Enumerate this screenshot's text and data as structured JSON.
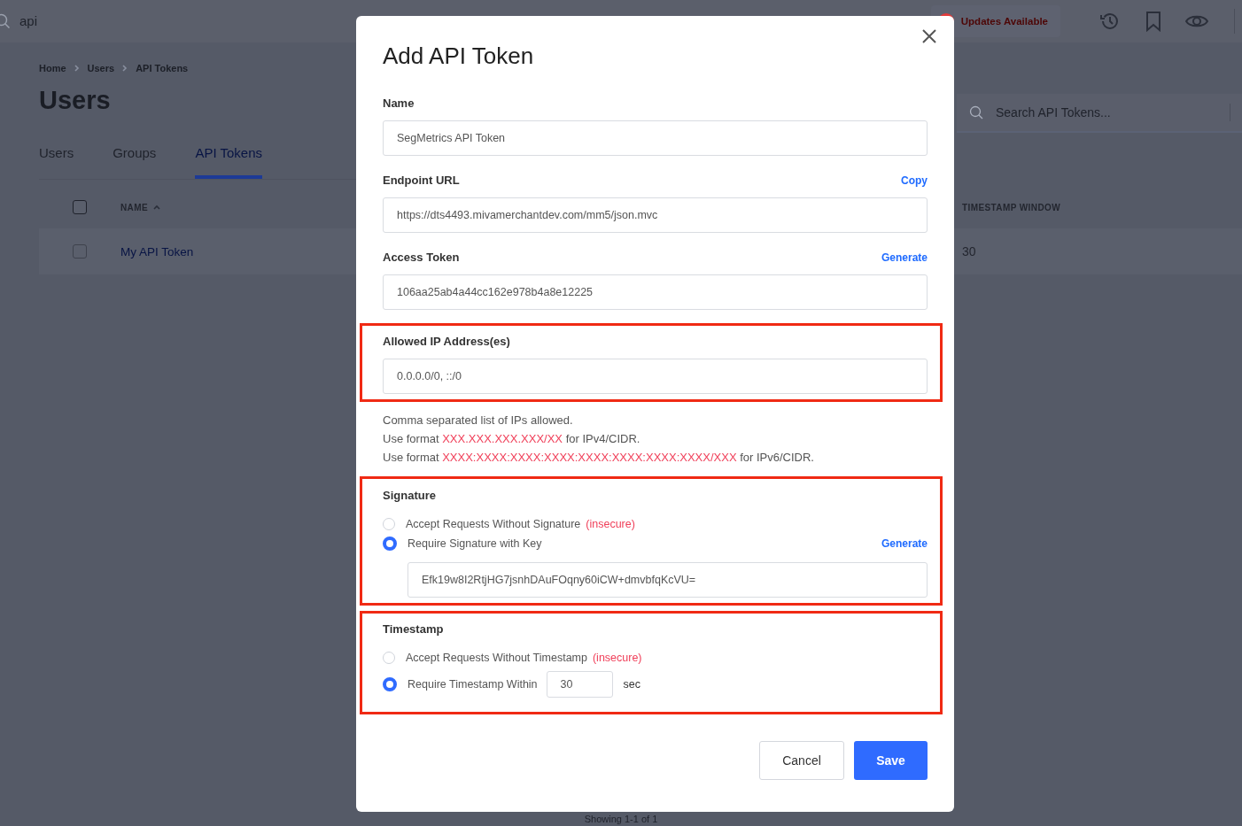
{
  "topbar": {
    "search_value": "api",
    "updates_badge": "Updates Available"
  },
  "breadcrumb": [
    "Home",
    "Users",
    "API Tokens"
  ],
  "page_title": "Users",
  "tabs": [
    {
      "label": "Users",
      "selected": false
    },
    {
      "label": "Groups",
      "selected": false
    },
    {
      "label": "API Tokens",
      "selected": true
    }
  ],
  "table_search": {
    "placeholder": "Search API Tokens..."
  },
  "table": {
    "select_all_checked": false,
    "columns": [
      {
        "label": "NAME",
        "sorted": true
      },
      {
        "label": "TIMESTAMP WINDOW",
        "sorted": false
      }
    ],
    "rows": [
      {
        "checked": false,
        "name": "My API Token",
        "timestamp_window": "30"
      }
    ]
  },
  "footer": "Showing 1-1 of 1",
  "dialog": {
    "title": "Add API Token",
    "fields": [
      {
        "label": "Name",
        "value": "SegMetrics API Token"
      },
      {
        "label": "Endpoint URL",
        "action": "Copy",
        "value": "https://dts4493.mivamerchantdev.com/mm5/json.mvc"
      },
      {
        "label": "Access Token",
        "action": "Generate",
        "value": "106aa25ab4a44cc162e978b4a8e12225"
      }
    ],
    "allowed_ips": {
      "highlighted": true,
      "label": "Allowed IP Address(es)",
      "value": "0.0.0.0/0, ::/0",
      "help": [
        {
          "text": "Comma separated list of IPs allowed."
        },
        {
          "text": "Use format",
          "code": "XXX.XXX.XXX.XXX/XX",
          "suffix": "for IPv4/CIDR."
        },
        {
          "text": "Use format",
          "code": "XXXX:XXXX:XXXX:XXXX:XXXX:XXXX:XXXX:XXXX/XXX",
          "suffix": "for IPv6/CIDR."
        }
      ]
    },
    "signature": {
      "highlighted": true,
      "label": "Signature",
      "options": [
        {
          "label": "Accept Requests Without Signature",
          "tag": "(insecure)",
          "selected": false
        },
        {
          "label": "Require Signature with Key",
          "action": "Generate",
          "selected": true
        }
      ],
      "key_value": "Efk19w8I2RtjHG7jsnhDAuFOqny60iCW+dmvbfqKcVU="
    },
    "timestamp": {
      "highlighted": true,
      "label": "Timestamp",
      "options": [
        {
          "label": "Accept Requests Without Timestamp",
          "tag": "(insecure)",
          "selected": false
        },
        {
          "label": "Require Timestamp Within",
          "selected": true
        }
      ],
      "window_value": "30",
      "unit": "sec"
    },
    "buttons": [
      {
        "label": "Cancel",
        "kind": "secondary"
      },
      {
        "label": "Save",
        "kind": "primary"
      }
    ]
  }
}
